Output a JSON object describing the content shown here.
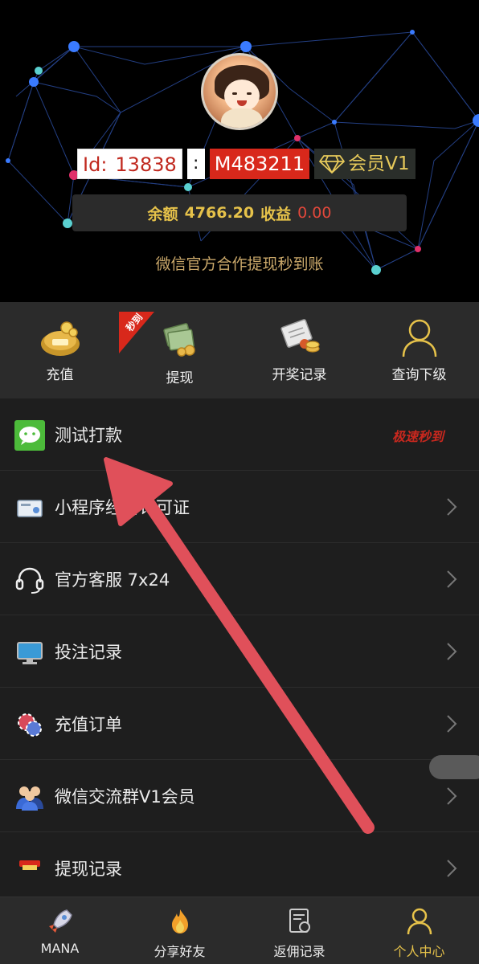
{
  "profile": {
    "id_label": "Id:",
    "id_value": "13838",
    "separator": ":",
    "code": "M483211",
    "vip_label": "会员V1"
  },
  "balance": {
    "balance_label": "余额",
    "balance_value": "4766.20",
    "income_label": "收益",
    "income_value": "0.00"
  },
  "notice": "微信官方合作提现秒到账",
  "shortcuts": [
    {
      "label": "充值",
      "icon": "money-bag-icon"
    },
    {
      "label": "提现",
      "icon": "cash-stack-icon",
      "badge": "秒到"
    },
    {
      "label": "开奖记录",
      "icon": "document-coins-icon"
    },
    {
      "label": "查询下级",
      "icon": "user-outline-icon"
    }
  ],
  "menu": [
    {
      "label": "测试打款",
      "icon": "wechat-icon",
      "promo": "极速秒到"
    },
    {
      "label": "小程序经营许可证",
      "icon": "certificate-icon"
    },
    {
      "label": "官方客服 7x24",
      "icon": "headset-icon"
    },
    {
      "label": "投注记录",
      "icon": "monitor-icon"
    },
    {
      "label": "充值订单",
      "icon": "chips-icon"
    },
    {
      "label": "微信交流群V1会员",
      "icon": "group-icon"
    },
    {
      "label": "提现记录",
      "icon": "withdraw-icon"
    }
  ],
  "bottom_nav": [
    {
      "label": "MANA",
      "icon": "rocket-icon"
    },
    {
      "label": "分享好友",
      "icon": "flame-icon"
    },
    {
      "label": "返佣记录",
      "icon": "receipt-icon"
    },
    {
      "label": "个人中心",
      "icon": "user-icon",
      "active": true
    }
  ],
  "colors": {
    "accent_gold": "#e6c24a",
    "accent_red": "#d8281b",
    "annotation_arrow": "#e0505a"
  }
}
